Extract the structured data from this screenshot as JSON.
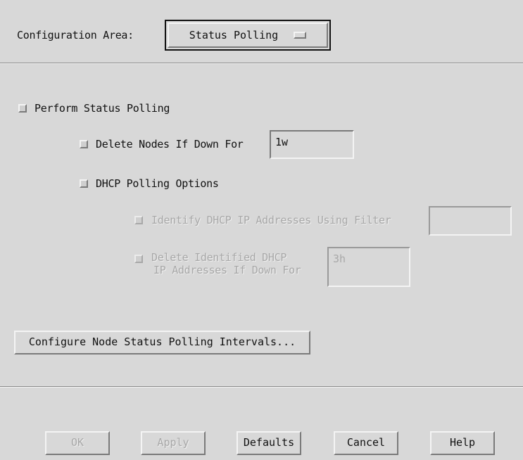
{
  "header": {
    "config_area_label": "Configuration Area:",
    "config_area_value": "Status Polling"
  },
  "options": {
    "perform_status_polling": "Perform Status Polling",
    "delete_nodes_label": "Delete Nodes If Down For",
    "delete_nodes_value": "1w",
    "dhcp_polling_label": "DHCP Polling Options",
    "identify_dhcp_label": "Identify DHCP IP Addresses Using Filter",
    "identify_dhcp_value": "",
    "delete_identified_label_line1": "Delete Identified DHCP",
    "delete_identified_label_line2": "IP Addresses If Down For",
    "delete_identified_value": "3h"
  },
  "configure_button": "Configure Node Status Polling Intervals...",
  "footer": {
    "ok": "OK",
    "apply": "Apply",
    "defaults": "Defaults",
    "cancel": "Cancel",
    "help": "Help"
  }
}
